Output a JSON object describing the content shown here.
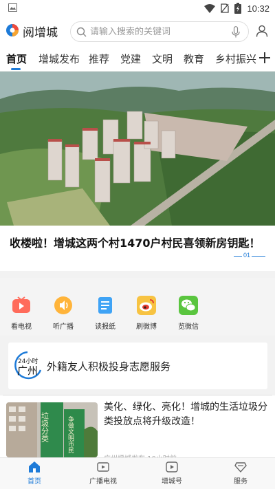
{
  "status_bar": {
    "time": "10:32"
  },
  "header": {
    "app_name": "阅增城",
    "search_placeholder": "请输入搜索的关键词"
  },
  "tabs": [
    {
      "label": "首页",
      "active": true
    },
    {
      "label": "增城发布"
    },
    {
      "label": "推荐"
    },
    {
      "label": "党建"
    },
    {
      "label": "文明"
    },
    {
      "label": "教育"
    },
    {
      "label": "乡村振兴"
    }
  ],
  "banner": {
    "headline": "收楼啦！增城这两个村1470户村民喜领新房钥匙！",
    "page_indicator": "01"
  },
  "quick_entries": [
    {
      "label": "看电视",
      "icon": "tv-icon",
      "color": "#ff6b5b"
    },
    {
      "label": "听广播",
      "icon": "radio-icon",
      "color": "#ffb43a"
    },
    {
      "label": "读报纸",
      "icon": "newspaper-icon",
      "color": "#3fa3f5"
    },
    {
      "label": "刷微博",
      "icon": "weibo-icon",
      "color": "#f7c342"
    },
    {
      "label": "览微信",
      "icon": "wechat-icon",
      "color": "#5ac53f"
    }
  ],
  "special": {
    "logo_text": "广州",
    "logo_badge": "24小时",
    "title": "外籍友人积极投身志愿服务"
  },
  "article": {
    "title": "美化、绿化、亮化！增城的生活垃圾分类投放点将升级改造！",
    "meta": "广州增城发布  10小时前",
    "sign_left": "垃圾分类",
    "sign_right": "争做文明市民"
  },
  "bottom_nav": [
    {
      "label": "首页",
      "icon": "home-icon",
      "active": true
    },
    {
      "label": "广播电视",
      "icon": "broadcast-icon"
    },
    {
      "label": "增城号",
      "icon": "channel-icon"
    },
    {
      "label": "服务",
      "icon": "service-icon"
    }
  ],
  "colors": {
    "accent": "#1e7bd8"
  }
}
